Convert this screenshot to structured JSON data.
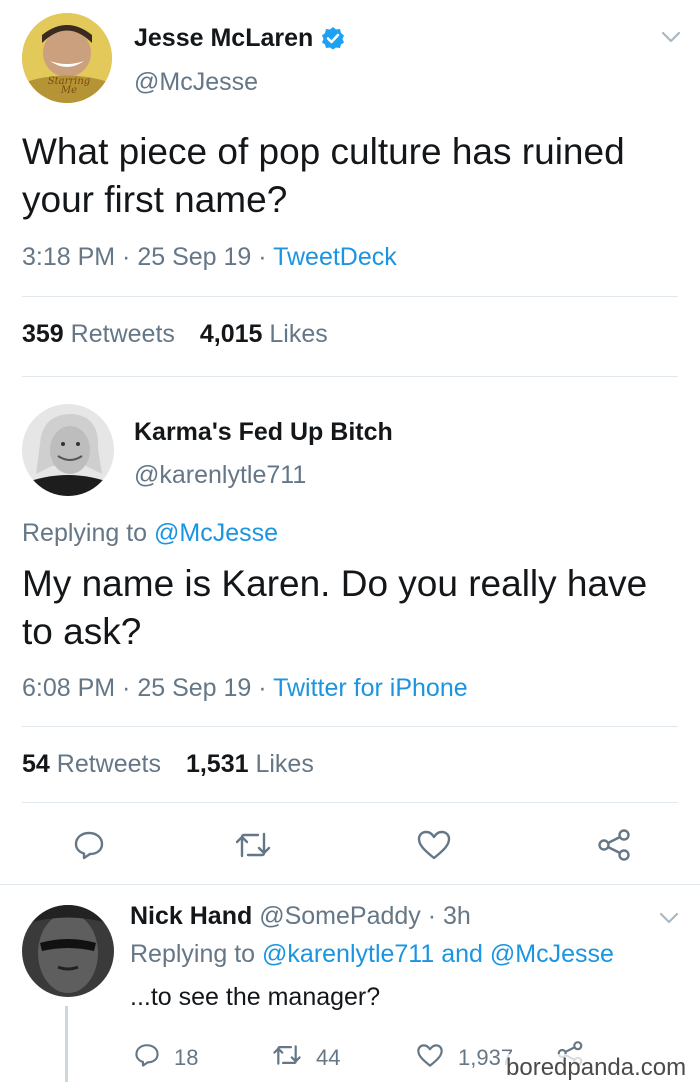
{
  "tweet1": {
    "name": "Jesse McLaren",
    "handle": "@McJesse",
    "avatar_text": "Starring Me",
    "text": "What piece of pop culture has ruined your first name?",
    "time": "3:18 PM",
    "date": "25 Sep 19",
    "client": "TweetDeck",
    "retweets_count": "359",
    "retweets_label": "Retweets",
    "likes_count": "4,015",
    "likes_label": "Likes"
  },
  "tweet2": {
    "name": "Karma's Fed Up Bitch",
    "handle": "@karenlytle711",
    "replying_prefix": "Replying to",
    "replying_to": "@McJesse",
    "text": "My name is Karen. Do you really have to ask?",
    "time": "6:08 PM",
    "date": "25 Sep 19",
    "client": "Twitter for iPhone",
    "retweets_count": "54",
    "retweets_label": "Retweets",
    "likes_count": "1,531",
    "likes_label": "Likes"
  },
  "tweet3": {
    "name": "Nick Hand",
    "handle": "@SomePaddy",
    "age": "3h",
    "replying_prefix": "Replying to",
    "replying_to_1": "@karenlytle711",
    "replying_and": "and",
    "replying_to_2": "@McJesse",
    "text": "...to see the manager?",
    "reply_count": "18",
    "retweet_count": "44",
    "like_count": "1,937"
  },
  "watermark": "boredpanda.com",
  "colors": {
    "accent": "#1b95e0",
    "text": "#14171a",
    "muted": "#657786",
    "divider": "#e1e8ed"
  }
}
